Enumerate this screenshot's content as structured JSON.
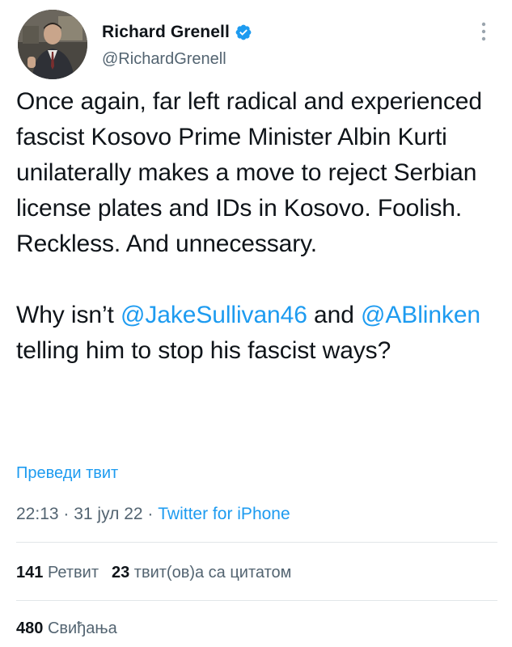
{
  "author": {
    "name": "Richard Grenell",
    "handle": "@RichardGrenell",
    "verified": true,
    "avatar_icon": "profile-photo"
  },
  "tweet": {
    "paragraph1": "Once again, far left radical and experienced fascist Kosovo Prime Minister Albin Kurti unilaterally makes a move to reject Serbian license plates and IDs in Kosovo. Foolish. Reckless. And unnecessary.",
    "p2_start": "Why isn’t ",
    "mention1": "@JakeSullivan46",
    "p2_mid": " and ",
    "mention2": "@ABlinken",
    "p2_end": " telling him to stop his fascist ways?"
  },
  "translate_label": "Преведи твит",
  "meta": {
    "time": "22:13",
    "sep1": " · ",
    "date": "31 јул 22",
    "sep2": " · ",
    "source": "Twitter for iPhone"
  },
  "stats": {
    "retweets_count": "141",
    "retweets_label": "Ретвит",
    "quotes_count": "23",
    "quotes_label": "твит(ов)а са цитатом",
    "likes_count": "480",
    "likes_label": "Свиђања"
  },
  "colors": {
    "accent": "#1d9bf0",
    "text": "#0f1419",
    "secondary": "#536471",
    "divider": "#e2e6e9"
  }
}
